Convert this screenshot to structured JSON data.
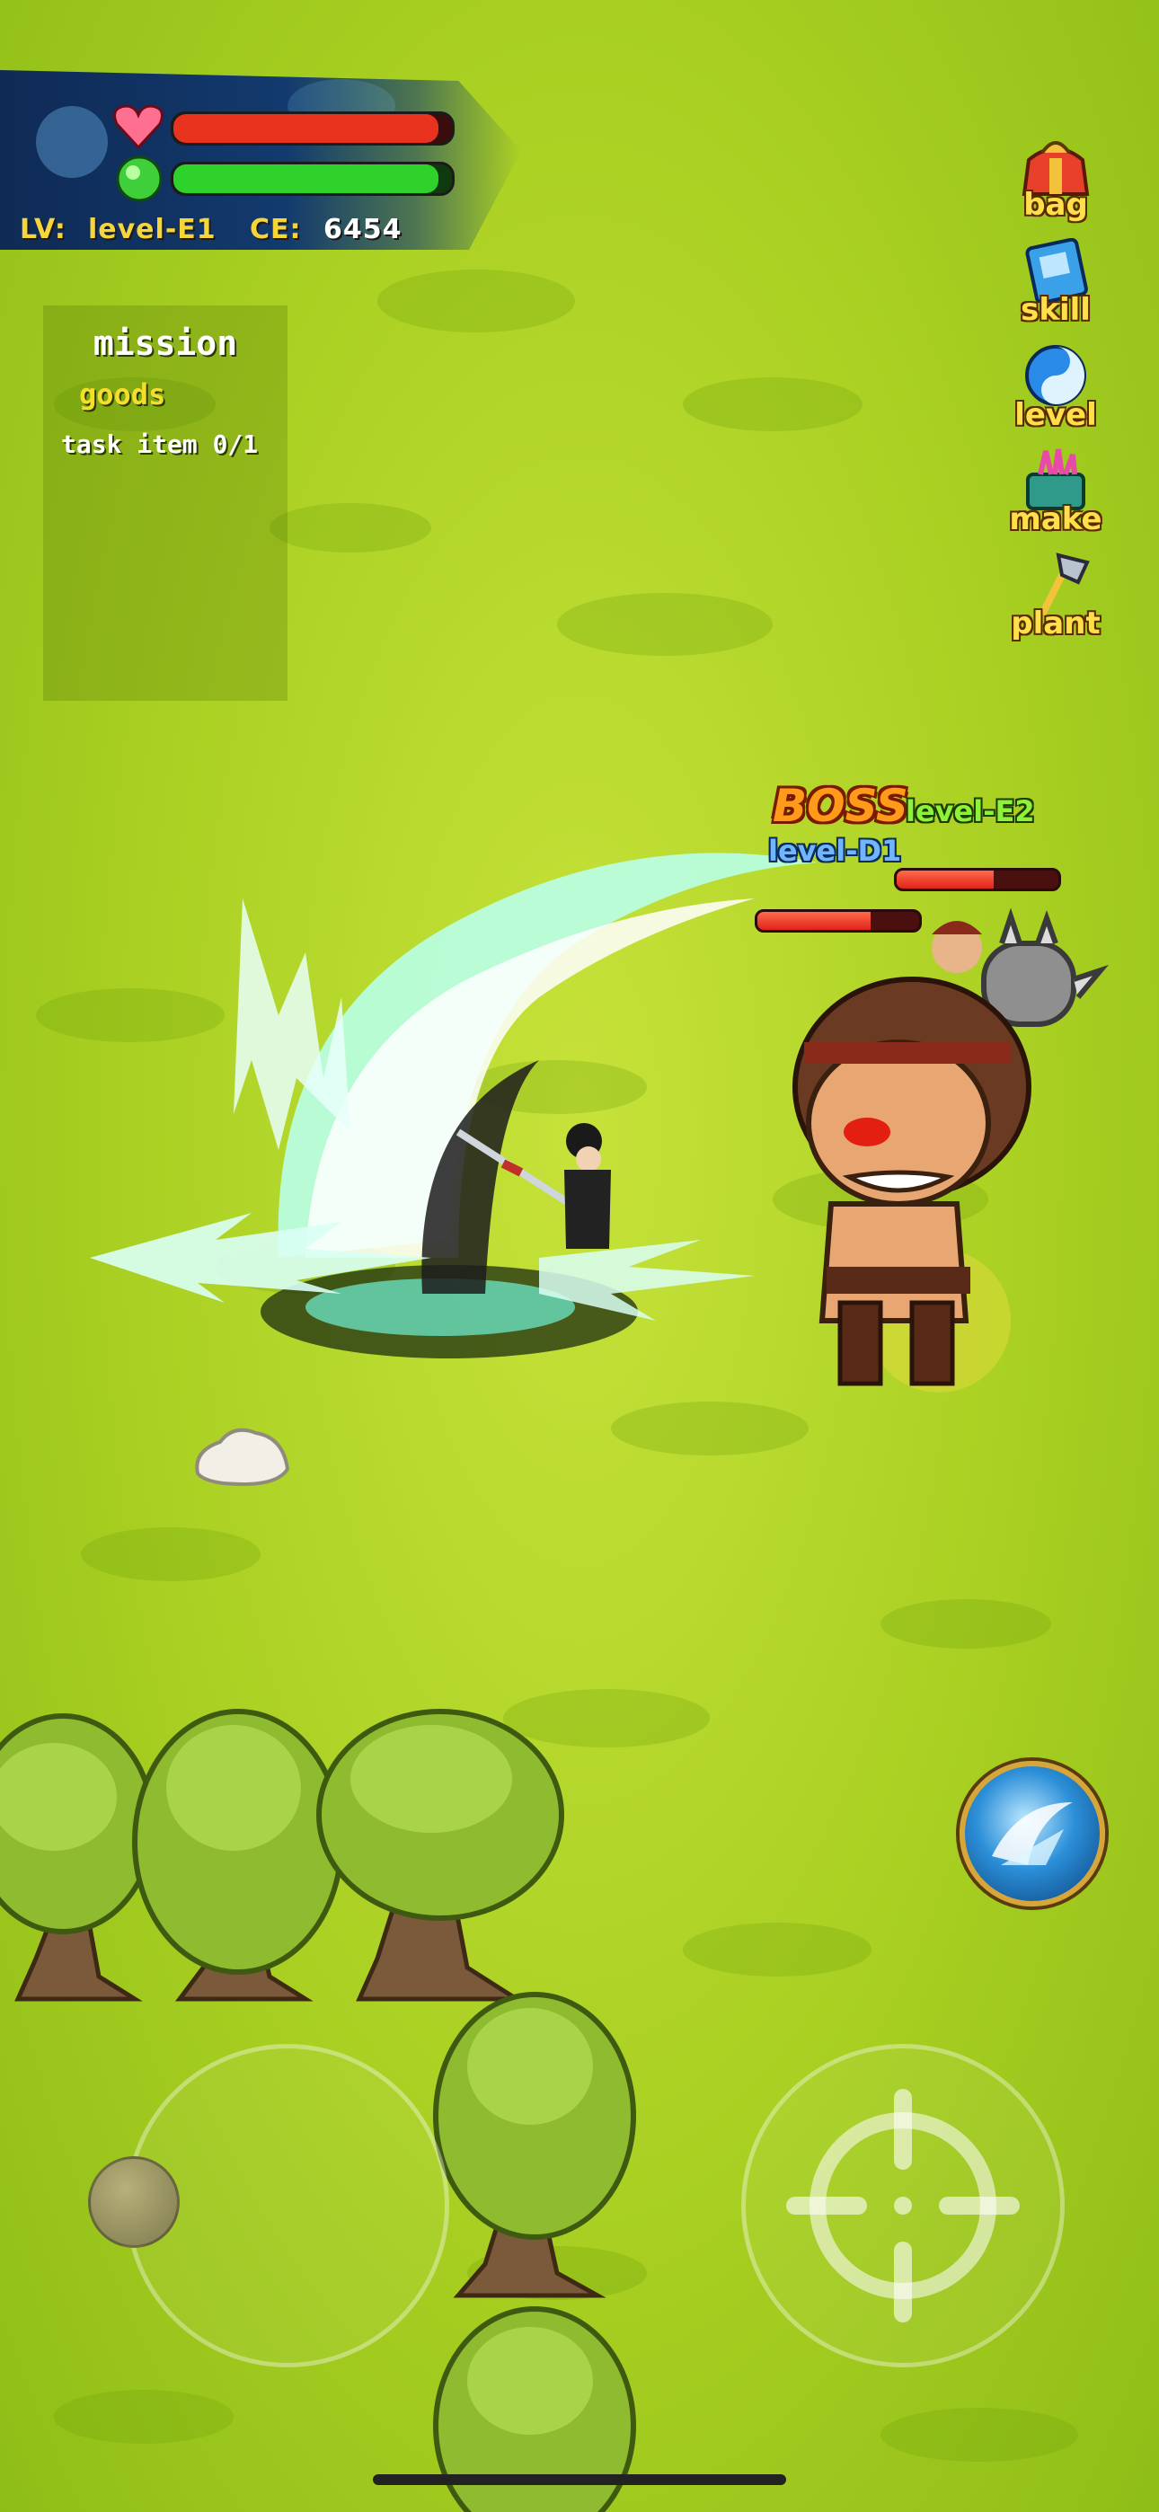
{
  "hud": {
    "level_label": "LV:",
    "level_value": "level-E1",
    "ce_label": "CE:",
    "ce_value": "6454",
    "hp_fraction": 0.95,
    "mp_fraction": 0.95,
    "colors": {
      "hp": "#e8331f",
      "mp": "#2fd22a",
      "text": "#f5d53a"
    }
  },
  "mission": {
    "title": "mission",
    "category": "goods",
    "task": "task item 0/1"
  },
  "side_menu": {
    "items": [
      {
        "label": "bag",
        "icon": "gift-bag-icon"
      },
      {
        "label": "skill",
        "icon": "skill-book-icon"
      },
      {
        "label": "level",
        "icon": "yin-yang-orb-icon"
      },
      {
        "label": "make",
        "icon": "crafting-chest-icon"
      },
      {
        "label": "plant",
        "icon": "hoe-icon"
      }
    ]
  },
  "boss": {
    "tag": "BOSS",
    "level": "level-E2",
    "hp_fraction": 0.6
  },
  "enemy": {
    "level": "level-D1",
    "hp_fraction": 0.7
  },
  "controls": {
    "joystick": "virtual-joystick",
    "attack": "crosshair-icon",
    "skill": "wind-slash-skill-icon"
  }
}
